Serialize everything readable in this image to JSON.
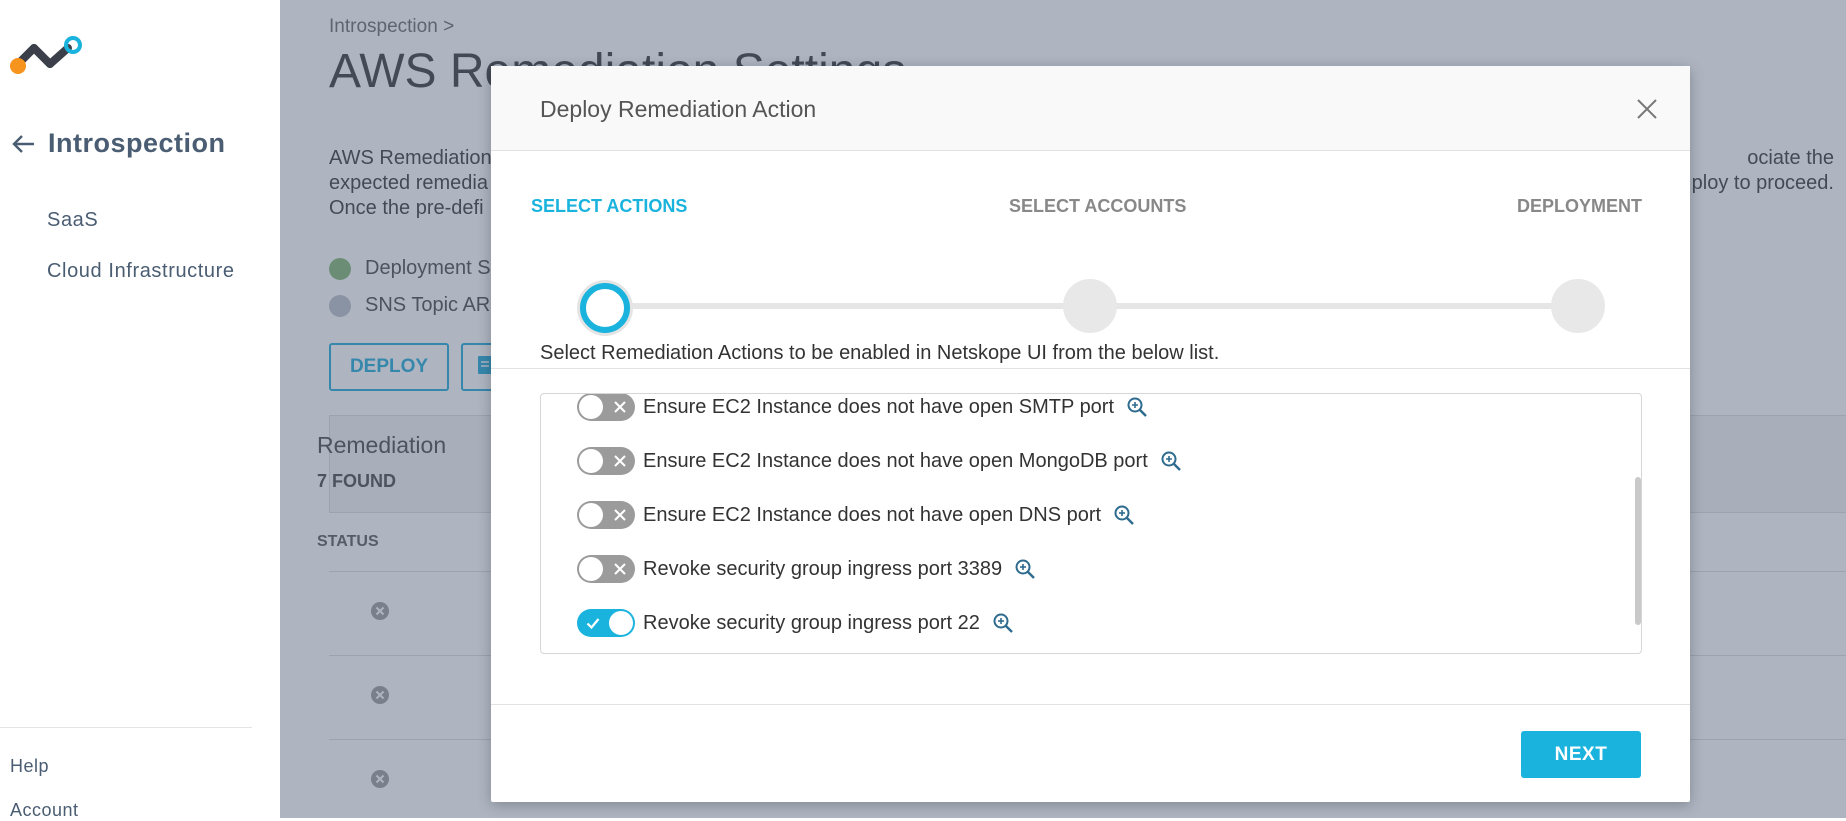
{
  "sidebar": {
    "title": "Introspection",
    "items": [
      {
        "label": "SaaS"
      },
      {
        "label": "Cloud Infrastructure"
      }
    ],
    "footer": [
      {
        "label": "Help"
      },
      {
        "label": "Account"
      }
    ]
  },
  "page": {
    "breadcrumb": "Introspection >",
    "title": "AWS Remediation Settings",
    "description": [
      "AWS Remediation",
      "expected remedia",
      "Once the pre-defi"
    ],
    "description_right": [
      "ociate the",
      "ploy to proceed."
    ],
    "legend": [
      {
        "label": "Deployment S",
        "color": "#7fb26f"
      },
      {
        "label": "SNS Topic ARN",
        "color": "#b9bec6"
      }
    ],
    "deploy_label": "DEPLOY",
    "table": {
      "title": "Remediation",
      "count": "7 FOUND",
      "status_header": "STATUS"
    }
  },
  "modal": {
    "title": "Deploy Remediation Action",
    "steps": [
      {
        "label": "SELECT ACTIONS",
        "state": "active"
      },
      {
        "label": "SELECT ACCOUNTS",
        "state": "pending"
      },
      {
        "label": "DEPLOYMENT",
        "state": "pending"
      }
    ],
    "instruction": "Select Remediation Actions to be enabled in Netskope UI from the below list.",
    "actions": [
      {
        "label": "Ensure EC2 Instance does not have open SMTP port",
        "enabled": false
      },
      {
        "label": "Ensure EC2 Instance does not have open MongoDB port",
        "enabled": false
      },
      {
        "label": "Ensure EC2 Instance does not have open DNS port",
        "enabled": false
      },
      {
        "label": "Revoke security group ingress port 3389",
        "enabled": false
      },
      {
        "label": "Revoke security group ingress port 22",
        "enabled": true
      }
    ],
    "next_label": "NEXT"
  },
  "colors": {
    "accent": "#1ab3dd",
    "toggle_off": "#9b9b9b",
    "sidebar_text": "#4a5d72"
  }
}
